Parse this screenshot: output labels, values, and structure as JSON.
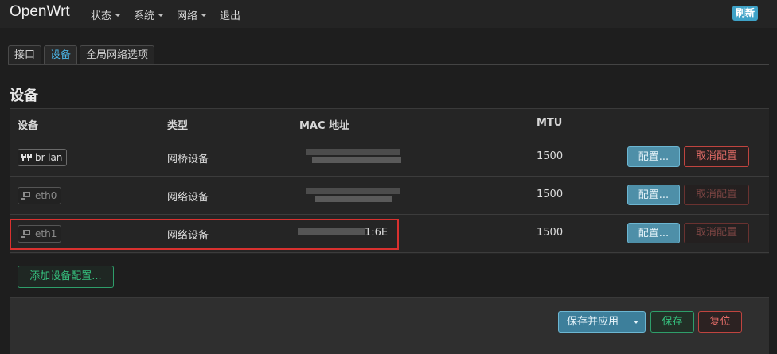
{
  "brand": "OpenWrt",
  "menu": [
    "状态",
    "系统",
    "网络",
    "退出"
  ],
  "refresh_badge": "刷新",
  "tabs": [
    "接口",
    "设备",
    "全局网络选项"
  ],
  "section_title": "设备",
  "table": {
    "headers": [
      "设备",
      "类型",
      "MAC 地址",
      "MTU"
    ],
    "rows": [
      {
        "device": "br-lan",
        "type": "网桥设备",
        "mac": "",
        "mtu": "1500",
        "config": "配置...",
        "unconfig": "取消配置",
        "icon": "bridge-icon",
        "unconfig_enabled": true
      },
      {
        "device": "eth0",
        "type": "网络设备",
        "mac": "",
        "mtu": "1500",
        "config": "配置...",
        "unconfig": "取消配置",
        "icon": "ethernet-port-icon",
        "unconfig_enabled": false
      },
      {
        "device": "eth1",
        "type": "网络设备",
        "mac": "1:6E",
        "mtu": "1500",
        "config": "配置...",
        "unconfig": "取消配置",
        "icon": "ethernet-port-icon",
        "unconfig_enabled": false
      }
    ]
  },
  "add_device_config": "添加设备配置...",
  "footer": {
    "save_apply": "保存并应用",
    "save": "保存",
    "reset": "复位"
  },
  "colors": {
    "accent": "#4cb7e8",
    "primary_button": "#4e8fa8",
    "danger": "#c0443f",
    "success": "#2e9e6a",
    "highlight": "#d9312f"
  }
}
